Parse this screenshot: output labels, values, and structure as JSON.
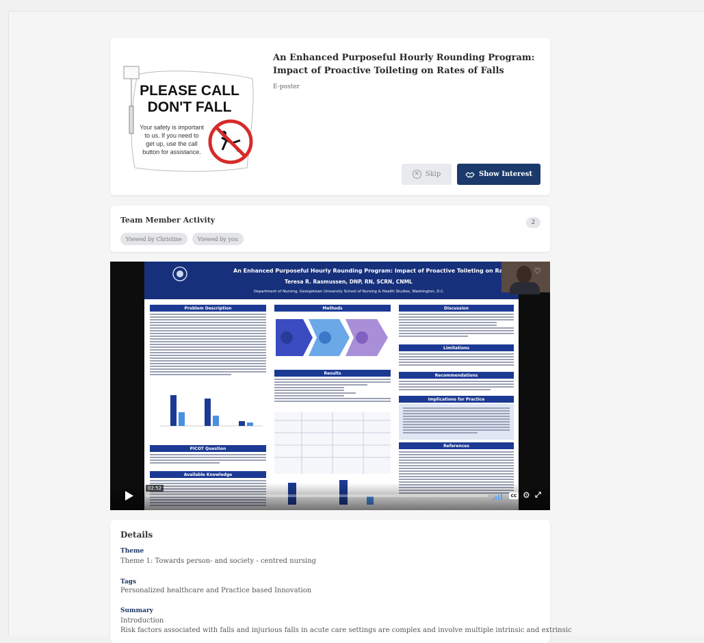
{
  "hero": {
    "title": "An Enhanced Purposeful Hourly Rounding Program: Impact of Proactive Toileting on Rates of Falls",
    "type": "E-poster",
    "thumbnail": {
      "headline_line1": "PLEASE CALL",
      "headline_line2": "DON'T FALL",
      "body_lines": [
        "Your safety is important",
        "to us. If you need to",
        "get up, use the call",
        "button for assistance."
      ],
      "badge_color": "#d62b2b"
    },
    "skip_label": "Skip",
    "interest_label": "Show Interest",
    "accent_color": "#1b3a6b"
  },
  "team": {
    "title": "Team Member Activity",
    "count": "2",
    "chips": [
      "Viewed by Christine",
      "Viewed by you"
    ]
  },
  "video": {
    "poster": {
      "title": "An Enhanced Purposeful Hourly Rounding Program: Impact of Proactive Toileting on Rates of Falls",
      "author": "Teresa R. Rasmussen, DNP, RN, SCRN, CNML",
      "department": "Department of Nursing, Georgetown University School of Nursing & Health Studies, Washington, D.C.",
      "sections_left": [
        "Problem Description",
        "PICOT Question",
        "Available Knowledge"
      ],
      "sections_middle": [
        "Methods",
        "Results"
      ],
      "sections_right": [
        "Discussion",
        "Limitations",
        "Recommendations",
        "Implications for Practice",
        "References"
      ],
      "header_color": "#16307b"
    },
    "timecode": "02:52",
    "cc_label": "CC",
    "play_icon": "play-icon",
    "heart_icon": "heart-icon",
    "settings_icon": "gear-icon",
    "fullscreen_icon": "fullscreen-icon"
  },
  "details": {
    "title": "Details",
    "theme_label": "Theme",
    "theme_value": "Theme 1: Towards person- and society - centred nursing",
    "tags_label": "Tags",
    "tags_value": "Personalized healthcare and Practice based Innovation",
    "summary_label": "Summary",
    "summary_intro": "Introduction",
    "summary_text": "Risk factors associated with falls and injurious falls in acute care settings are complex and involve multiple intrinsic and extrinsic"
  }
}
